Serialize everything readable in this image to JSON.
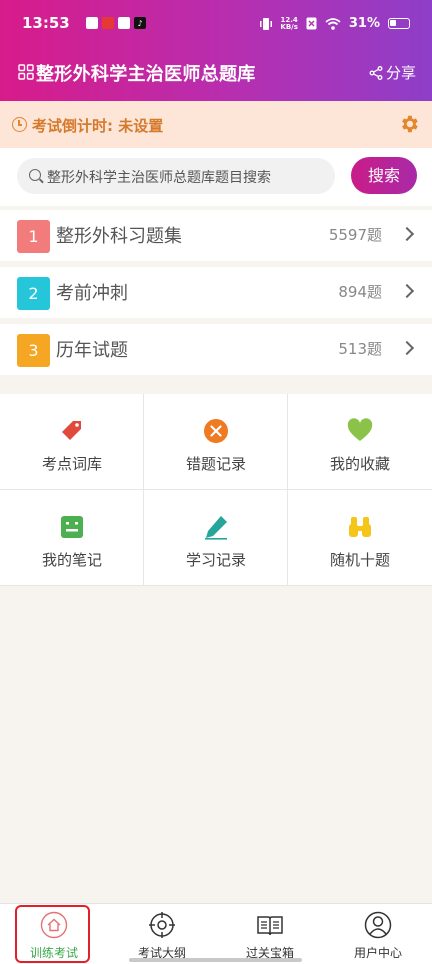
{
  "status_bar": {
    "time": "13:53",
    "net_speed_top": "12.4",
    "net_speed_bottom": "KB/s",
    "battery": "31%"
  },
  "app_title": "整形外科学主治医师总题库",
  "share_label": "分享",
  "countdown_text": "考试倒计时: 未设置",
  "search": {
    "placeholder": "整形外科学主治医师总题库题目搜索",
    "button_label": "搜索"
  },
  "categories": [
    {
      "num": "1",
      "label": "整形外科习题集",
      "count": "5597题",
      "color": "#f27b7b"
    },
    {
      "num": "2",
      "label": "考前冲刺",
      "count": "894题",
      "color": "#26c6da"
    },
    {
      "num": "3",
      "label": "历年试题",
      "count": "513题",
      "color": "#f5a623"
    }
  ],
  "grid": [
    {
      "label": "考点词库",
      "icon": "tag-icon",
      "color": "#e0493b"
    },
    {
      "label": "错题记录",
      "icon": "x-circle-icon",
      "color": "#ee7a22"
    },
    {
      "label": "我的收藏",
      "icon": "heart-icon",
      "color": "#8bc34a"
    },
    {
      "label": "我的笔记",
      "icon": "note-icon",
      "color": "#4caf50"
    },
    {
      "label": "学习记录",
      "icon": "pencil-icon",
      "color": "#26a69a"
    },
    {
      "label": "随机十题",
      "icon": "binoculars-icon",
      "color": "#f5c518"
    }
  ],
  "tabs": [
    {
      "label": "训练考试",
      "icon": "home-icon",
      "active": true
    },
    {
      "label": "考试大纲",
      "icon": "target-icon",
      "active": false
    },
    {
      "label": "过关宝箱",
      "icon": "book-icon",
      "active": false
    },
    {
      "label": "用户中心",
      "icon": "user-icon",
      "active": false
    }
  ],
  "colors": {
    "header_start": "#d81b8a",
    "header_end": "#8e3ec8",
    "accent_green": "#3aa64a",
    "highlight_red": "#e3202a"
  }
}
